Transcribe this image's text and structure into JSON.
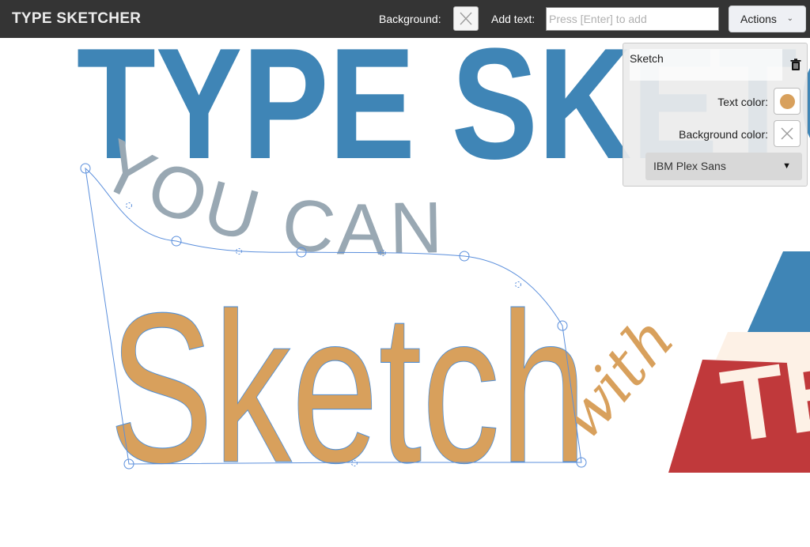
{
  "app": {
    "title": "TYPE SKETCHER"
  },
  "toolbar": {
    "background_label": "Background:",
    "add_text_label": "Add text:",
    "add_text_placeholder": "Press [Enter] to add",
    "add_text_value": "",
    "actions_label": "Actions"
  },
  "canvas": {
    "words": [
      {
        "text": "TYPE SKETCH",
        "color": "#3f85b6"
      },
      {
        "text": "YOU CAN",
        "color": "#99a8b3"
      },
      {
        "text": "Sketch",
        "color": "#d8a05c",
        "selected": true
      },
      {
        "text": "with",
        "color": "#d8a05c"
      },
      {
        "text": "TEXT",
        "color": "#c0393b"
      }
    ]
  },
  "panel": {
    "text_value": "Sketch",
    "text_color_label": "Text color:",
    "text_color": "#d8a05c",
    "background_color_label": "Background color:",
    "background_color": "none",
    "font_value": "IBM Plex Sans",
    "delete_icon": "trash-icon"
  },
  "icons": {
    "background_swatch": "none-x-icon",
    "actions_dropdown": "chevron-down-icon",
    "font_dropdown": "caret-down-icon"
  }
}
